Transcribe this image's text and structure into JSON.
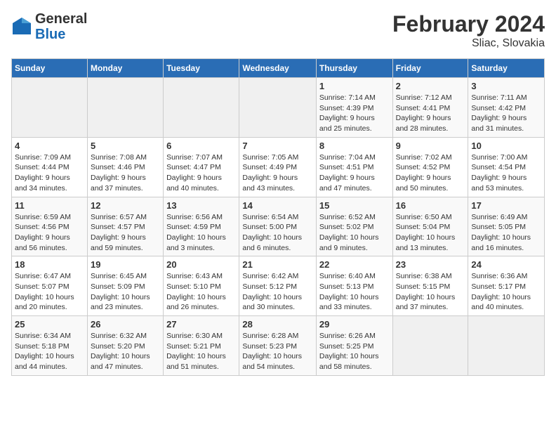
{
  "header": {
    "logo_general": "General",
    "logo_blue": "Blue",
    "title": "February 2024",
    "subtitle": "Sliac, Slovakia"
  },
  "days_of_week": [
    "Sunday",
    "Monday",
    "Tuesday",
    "Wednesday",
    "Thursday",
    "Friday",
    "Saturday"
  ],
  "weeks": [
    [
      {
        "day": "",
        "info": ""
      },
      {
        "day": "",
        "info": ""
      },
      {
        "day": "",
        "info": ""
      },
      {
        "day": "",
        "info": ""
      },
      {
        "day": "1",
        "info": "Sunrise: 7:14 AM\nSunset: 4:39 PM\nDaylight: 9 hours\nand 25 minutes."
      },
      {
        "day": "2",
        "info": "Sunrise: 7:12 AM\nSunset: 4:41 PM\nDaylight: 9 hours\nand 28 minutes."
      },
      {
        "day": "3",
        "info": "Sunrise: 7:11 AM\nSunset: 4:42 PM\nDaylight: 9 hours\nand 31 minutes."
      }
    ],
    [
      {
        "day": "4",
        "info": "Sunrise: 7:09 AM\nSunset: 4:44 PM\nDaylight: 9 hours\nand 34 minutes."
      },
      {
        "day": "5",
        "info": "Sunrise: 7:08 AM\nSunset: 4:46 PM\nDaylight: 9 hours\nand 37 minutes."
      },
      {
        "day": "6",
        "info": "Sunrise: 7:07 AM\nSunset: 4:47 PM\nDaylight: 9 hours\nand 40 minutes."
      },
      {
        "day": "7",
        "info": "Sunrise: 7:05 AM\nSunset: 4:49 PM\nDaylight: 9 hours\nand 43 minutes."
      },
      {
        "day": "8",
        "info": "Sunrise: 7:04 AM\nSunset: 4:51 PM\nDaylight: 9 hours\nand 47 minutes."
      },
      {
        "day": "9",
        "info": "Sunrise: 7:02 AM\nSunset: 4:52 PM\nDaylight: 9 hours\nand 50 minutes."
      },
      {
        "day": "10",
        "info": "Sunrise: 7:00 AM\nSunset: 4:54 PM\nDaylight: 9 hours\nand 53 minutes."
      }
    ],
    [
      {
        "day": "11",
        "info": "Sunrise: 6:59 AM\nSunset: 4:56 PM\nDaylight: 9 hours\nand 56 minutes."
      },
      {
        "day": "12",
        "info": "Sunrise: 6:57 AM\nSunset: 4:57 PM\nDaylight: 9 hours\nand 59 minutes."
      },
      {
        "day": "13",
        "info": "Sunrise: 6:56 AM\nSunset: 4:59 PM\nDaylight: 10 hours\nand 3 minutes."
      },
      {
        "day": "14",
        "info": "Sunrise: 6:54 AM\nSunset: 5:00 PM\nDaylight: 10 hours\nand 6 minutes."
      },
      {
        "day": "15",
        "info": "Sunrise: 6:52 AM\nSunset: 5:02 PM\nDaylight: 10 hours\nand 9 minutes."
      },
      {
        "day": "16",
        "info": "Sunrise: 6:50 AM\nSunset: 5:04 PM\nDaylight: 10 hours\nand 13 minutes."
      },
      {
        "day": "17",
        "info": "Sunrise: 6:49 AM\nSunset: 5:05 PM\nDaylight: 10 hours\nand 16 minutes."
      }
    ],
    [
      {
        "day": "18",
        "info": "Sunrise: 6:47 AM\nSunset: 5:07 PM\nDaylight: 10 hours\nand 20 minutes."
      },
      {
        "day": "19",
        "info": "Sunrise: 6:45 AM\nSunset: 5:09 PM\nDaylight: 10 hours\nand 23 minutes."
      },
      {
        "day": "20",
        "info": "Sunrise: 6:43 AM\nSunset: 5:10 PM\nDaylight: 10 hours\nand 26 minutes."
      },
      {
        "day": "21",
        "info": "Sunrise: 6:42 AM\nSunset: 5:12 PM\nDaylight: 10 hours\nand 30 minutes."
      },
      {
        "day": "22",
        "info": "Sunrise: 6:40 AM\nSunset: 5:13 PM\nDaylight: 10 hours\nand 33 minutes."
      },
      {
        "day": "23",
        "info": "Sunrise: 6:38 AM\nSunset: 5:15 PM\nDaylight: 10 hours\nand 37 minutes."
      },
      {
        "day": "24",
        "info": "Sunrise: 6:36 AM\nSunset: 5:17 PM\nDaylight: 10 hours\nand 40 minutes."
      }
    ],
    [
      {
        "day": "25",
        "info": "Sunrise: 6:34 AM\nSunset: 5:18 PM\nDaylight: 10 hours\nand 44 minutes."
      },
      {
        "day": "26",
        "info": "Sunrise: 6:32 AM\nSunset: 5:20 PM\nDaylight: 10 hours\nand 47 minutes."
      },
      {
        "day": "27",
        "info": "Sunrise: 6:30 AM\nSunset: 5:21 PM\nDaylight: 10 hours\nand 51 minutes."
      },
      {
        "day": "28",
        "info": "Sunrise: 6:28 AM\nSunset: 5:23 PM\nDaylight: 10 hours\nand 54 minutes."
      },
      {
        "day": "29",
        "info": "Sunrise: 6:26 AM\nSunset: 5:25 PM\nDaylight: 10 hours\nand 58 minutes."
      },
      {
        "day": "",
        "info": ""
      },
      {
        "day": "",
        "info": ""
      }
    ]
  ]
}
